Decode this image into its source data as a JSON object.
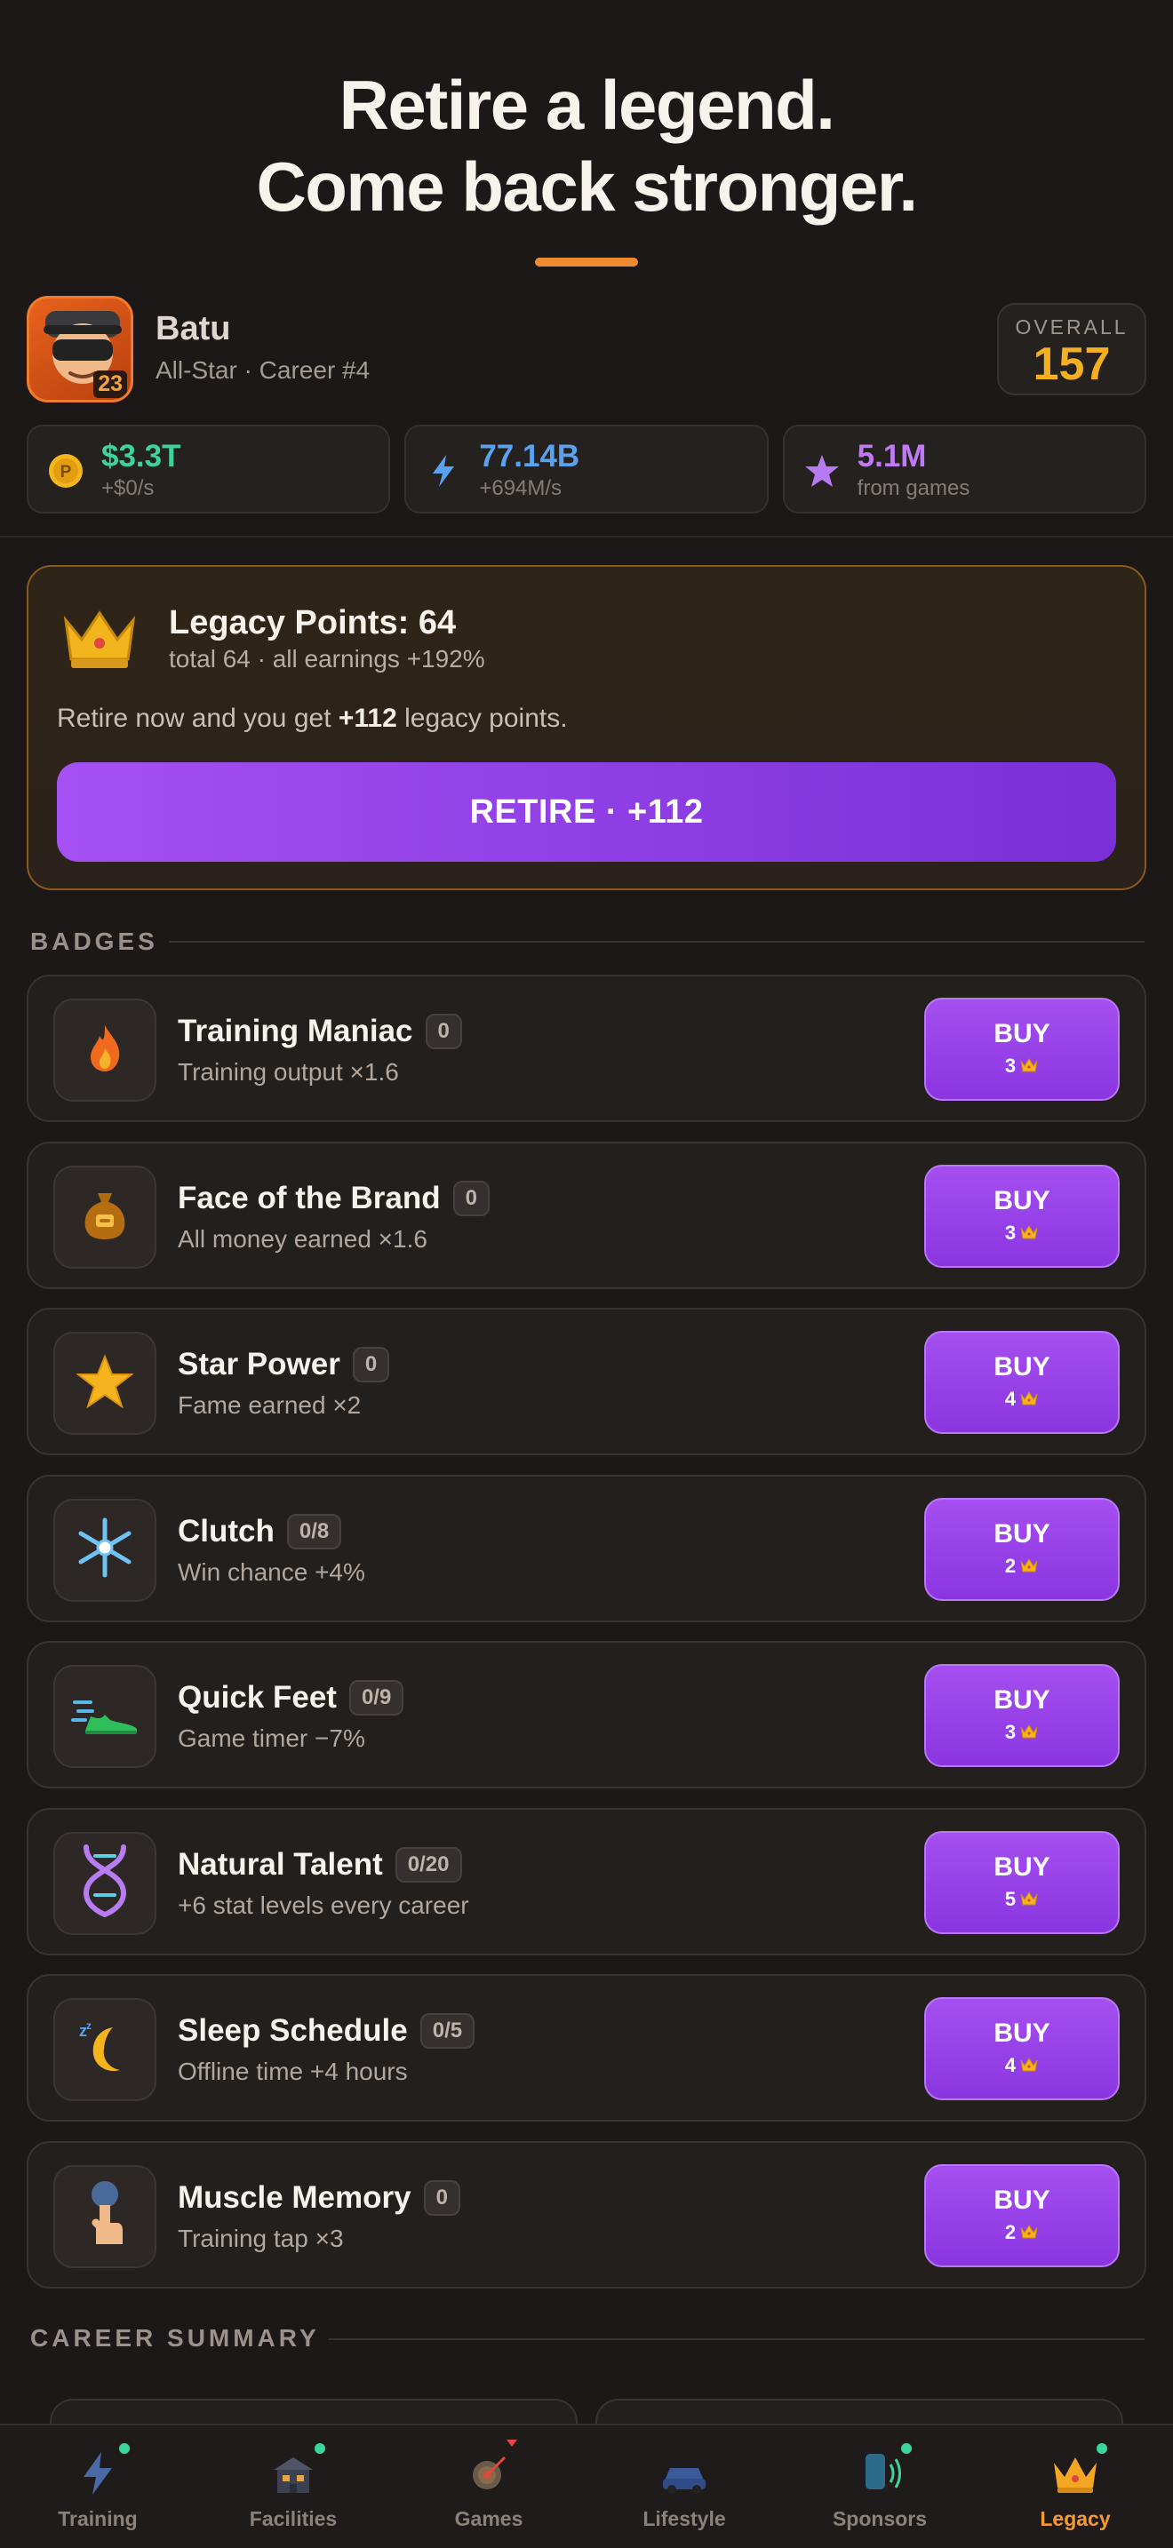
{
  "hero": {
    "line1": "Retire a legend.",
    "line2": "Come back stronger."
  },
  "player": {
    "name": "Batu",
    "subtitle": "All-Star · Career #4",
    "level": "23",
    "overall_label": "OVERALL",
    "overall_value": "157"
  },
  "stats": [
    {
      "icon": "coin-icon",
      "value": "$3.3T",
      "sub": "+$0/s",
      "color": "#3fd39a"
    },
    {
      "icon": "lightning-icon",
      "value": "77.14B",
      "sub": "+694M/s",
      "color": "#5aa2f0"
    },
    {
      "icon": "star-icon",
      "value": "5.1M",
      "sub": "from games",
      "color": "#c07af5"
    }
  ],
  "legacy": {
    "title": "Legacy Points: 64",
    "subtitle": "total 64 · all earnings +192%",
    "retire_prefix": "Retire now and you get ",
    "retire_points": "+112",
    "retire_suffix": " legacy points.",
    "button": "RETIRE · +112"
  },
  "sections": {
    "badges": "BADGES",
    "summary": "CAREER SUMMARY"
  },
  "buy_label": "BUY",
  "badges": [
    {
      "name": "Training Maniac",
      "count": "0",
      "desc": "Training output ×1.6",
      "cost": "3",
      "icon": "flame-icon"
    },
    {
      "name": "Face of the Brand",
      "count": "0",
      "desc": "All money earned ×1.6",
      "cost": "3",
      "icon": "money-bag-icon"
    },
    {
      "name": "Star Power",
      "count": "0",
      "desc": "Fame earned ×2",
      "cost": "4",
      "icon": "star-icon"
    },
    {
      "name": "Clutch",
      "count": "0/8",
      "desc": "Win chance +4%",
      "cost": "2",
      "icon": "snowflake-icon"
    },
    {
      "name": "Quick Feet",
      "count": "0/9",
      "desc": "Game timer −7%",
      "cost": "3",
      "icon": "sneaker-icon"
    },
    {
      "name": "Natural Talent",
      "count": "0/20",
      "desc": "+6 stat levels every career",
      "cost": "5",
      "icon": "dna-icon"
    },
    {
      "name": "Sleep Schedule",
      "count": "0/5",
      "desc": "Offline time +4 hours",
      "cost": "4",
      "icon": "moon-icon"
    },
    {
      "name": "Muscle Memory",
      "count": "0",
      "desc": "Training tap ×3",
      "cost": "2",
      "icon": "tap-finger-icon"
    }
  ],
  "tabs": [
    {
      "label": "Training",
      "icon": "lightning-icon",
      "dot": true
    },
    {
      "label": "Facilities",
      "icon": "building-icon",
      "dot": true
    },
    {
      "label": "Games",
      "icon": "target-icon",
      "dot": false
    },
    {
      "label": "Lifestyle",
      "icon": "car-icon",
      "dot": false
    },
    {
      "label": "Sponsors",
      "icon": "phone-icon",
      "dot": true
    },
    {
      "label": "Legacy",
      "icon": "crown-icon",
      "dot": true,
      "active": true
    }
  ]
}
